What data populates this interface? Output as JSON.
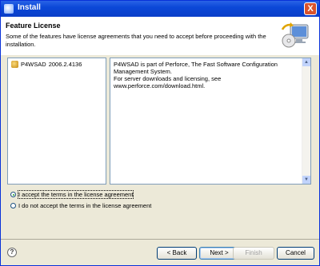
{
  "window": {
    "title": "Install",
    "close_glyph": "X"
  },
  "banner": {
    "heading": "Feature License",
    "message": "Some of the features have license agreements that you need to accept before proceeding with the installation."
  },
  "features": [
    {
      "name": "P4WSAD",
      "version": "2006.2.4136"
    }
  ],
  "license_text": {
    "line1": "P4WSAD is part of Perforce, The Fast Software Configuration Management System.",
    "line2": "For server downloads and licensing, see www.perforce.com/download.html."
  },
  "radios": {
    "accept": "I accept the terms in the license agreement",
    "decline": "I do not accept the terms in the license agreement"
  },
  "buttons": {
    "help": "?",
    "back": "< Back",
    "next": "Next >",
    "finish": "Finish",
    "cancel": "Cancel"
  }
}
